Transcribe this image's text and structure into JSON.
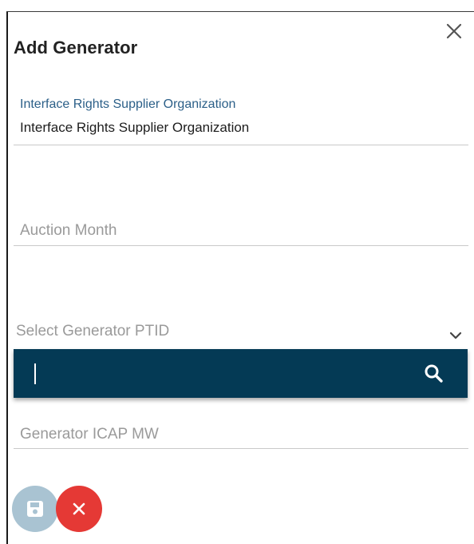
{
  "dialog": {
    "title": "Add Generator",
    "close_icon": "close-icon"
  },
  "fields": {
    "organization": {
      "label": "Interface Rights Supplier Organization",
      "value": "Interface Rights Supplier Organization"
    },
    "auction_month": {
      "placeholder": "Auction Month"
    },
    "generator_ptid": {
      "placeholder": "Select Generator PTID",
      "arrow_icon": "chevron-down-icon"
    },
    "search": {
      "value": "",
      "icon": "search-icon"
    },
    "generator_icap_mw": {
      "placeholder": "Generator ICAP MW"
    }
  },
  "actions": {
    "save_icon": "save-icon",
    "cancel_icon": "close-icon"
  },
  "colors": {
    "label_blue": "#2b5f88",
    "search_panel": "#043a55",
    "save_fab": "#a9c3d2",
    "cancel_fab": "#e53935"
  }
}
